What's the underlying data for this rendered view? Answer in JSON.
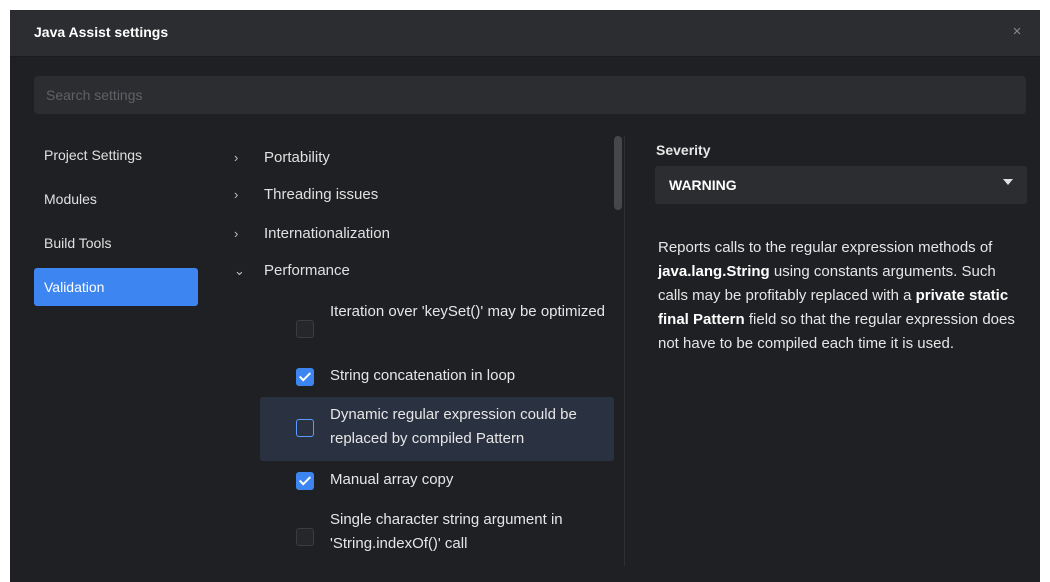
{
  "window": {
    "title": "Java Assist settings",
    "close_glyph": "×"
  },
  "search": {
    "placeholder": "Search settings",
    "value": ""
  },
  "sidebar": {
    "items": [
      {
        "label": "Project Settings",
        "active": false
      },
      {
        "label": "Modules",
        "active": false
      },
      {
        "label": "Build Tools",
        "active": false
      },
      {
        "label": "Validation",
        "active": true
      }
    ]
  },
  "tree": {
    "categories": [
      {
        "label": "Portability",
        "expanded": false,
        "chevron": "›"
      },
      {
        "label": "Threading issues",
        "expanded": false,
        "chevron": "›"
      },
      {
        "label": "Internationalization",
        "expanded": false,
        "chevron": "›"
      },
      {
        "label": "Performance",
        "expanded": true,
        "chevron": "⌄"
      }
    ],
    "options": [
      {
        "label": "Iteration over 'keySet()' may be optimized",
        "checked": false
      },
      {
        "label": "String concatenation in loop",
        "checked": true
      },
      {
        "label": "Dynamic regular expression could be replaced by compiled Pattern",
        "checked": false,
        "selected": true
      },
      {
        "label": "Manual array copy",
        "checked": true
      },
      {
        "label": "Single character string argument in 'String.indexOf()' call",
        "checked": false
      }
    ]
  },
  "detail": {
    "severity_label": "Severity",
    "severity_value": "WARNING",
    "description": {
      "part1": "Reports calls to the regular expression methods of ",
      "bold1": "java.lang.String",
      "part2": " using constants arguments. Such calls may be profitably replaced with a ",
      "bold2": "private static final Pattern",
      "part3": " field so that the regular expression does not have to be compiled each time it is used."
    }
  },
  "colors": {
    "accent": "#3d85f0",
    "background": "#1f2023",
    "panel": "#2b2d30",
    "selected_row": "#2a3140"
  },
  "icons": {
    "close": "close-icon",
    "collapsed": "chevron-right-icon",
    "expanded": "chevron-down-icon",
    "dropdown": "caret-down-icon",
    "checked": "checkmark-icon"
  }
}
